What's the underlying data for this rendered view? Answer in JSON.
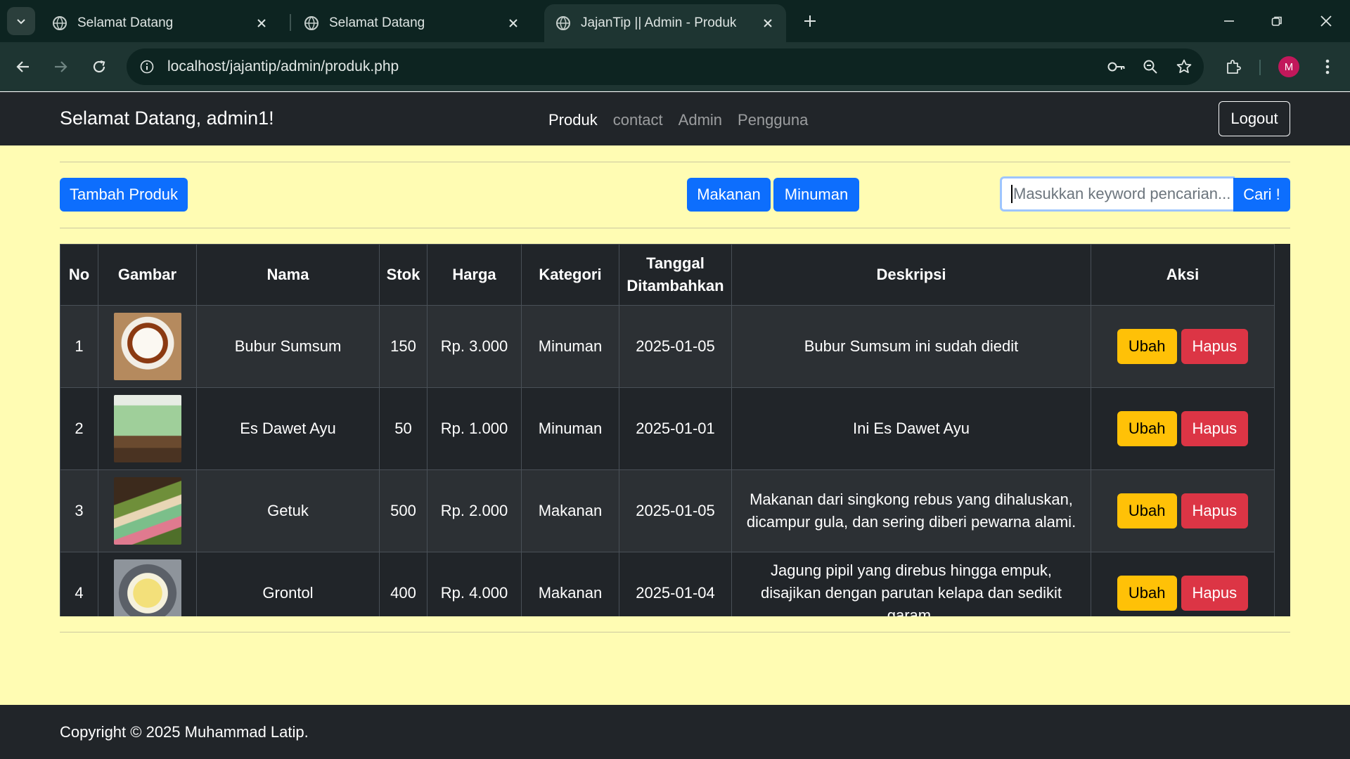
{
  "browser": {
    "tabs": [
      {
        "title": "Selamat Datang"
      },
      {
        "title": "Selamat Datang"
      },
      {
        "title": "JajanTip || Admin - Produk"
      }
    ],
    "url": "localhost/jajantip/admin/produk.php",
    "profile_initial": "M"
  },
  "navbar": {
    "brand": "Selamat Datang, admin1!",
    "links": [
      "Produk",
      "contact",
      "Admin",
      "Pengguna"
    ],
    "logout": "Logout"
  },
  "actions": {
    "add_product": "Tambah Produk",
    "filter_food": "Makanan",
    "filter_drink": "Minuman",
    "search_placeholder": "Masukkan keyword pencarian...",
    "search_button": "Cari !"
  },
  "table": {
    "headers": [
      "No",
      "Gambar",
      "Nama",
      "Stok",
      "Harga",
      "Kategori",
      "Tanggal Ditambahkan",
      "Deskripsi",
      "Aksi"
    ],
    "edit_label": "Ubah",
    "delete_label": "Hapus",
    "rows": [
      {
        "no": "1",
        "name": "Bubur Sumsum",
        "stock": "150",
        "price": "Rp. 3.000",
        "category": "Minuman",
        "date": "2025-01-05",
        "description": "Bubur Sumsum ini sudah diedit"
      },
      {
        "no": "2",
        "name": "Es Dawet Ayu",
        "stock": "50",
        "price": "Rp. 1.000",
        "category": "Minuman",
        "date": "2025-01-01",
        "description": "Ini Es Dawet Ayu"
      },
      {
        "no": "3",
        "name": "Getuk",
        "stock": "500",
        "price": "Rp. 2.000",
        "category": "Makanan",
        "date": "2025-01-05",
        "description": "Makanan dari singkong rebus yang dihaluskan, dicampur gula, dan sering diberi pewarna alami."
      },
      {
        "no": "4",
        "name": "Grontol",
        "stock": "400",
        "price": "Rp. 4.000",
        "category": "Makanan",
        "date": "2025-01-04",
        "description": "Jagung pipil yang direbus hingga empuk, disajikan dengan parutan kelapa dan sedikit garam."
      }
    ]
  },
  "footer": {
    "text": "Copyright © 2025 Muhammad Latip."
  }
}
